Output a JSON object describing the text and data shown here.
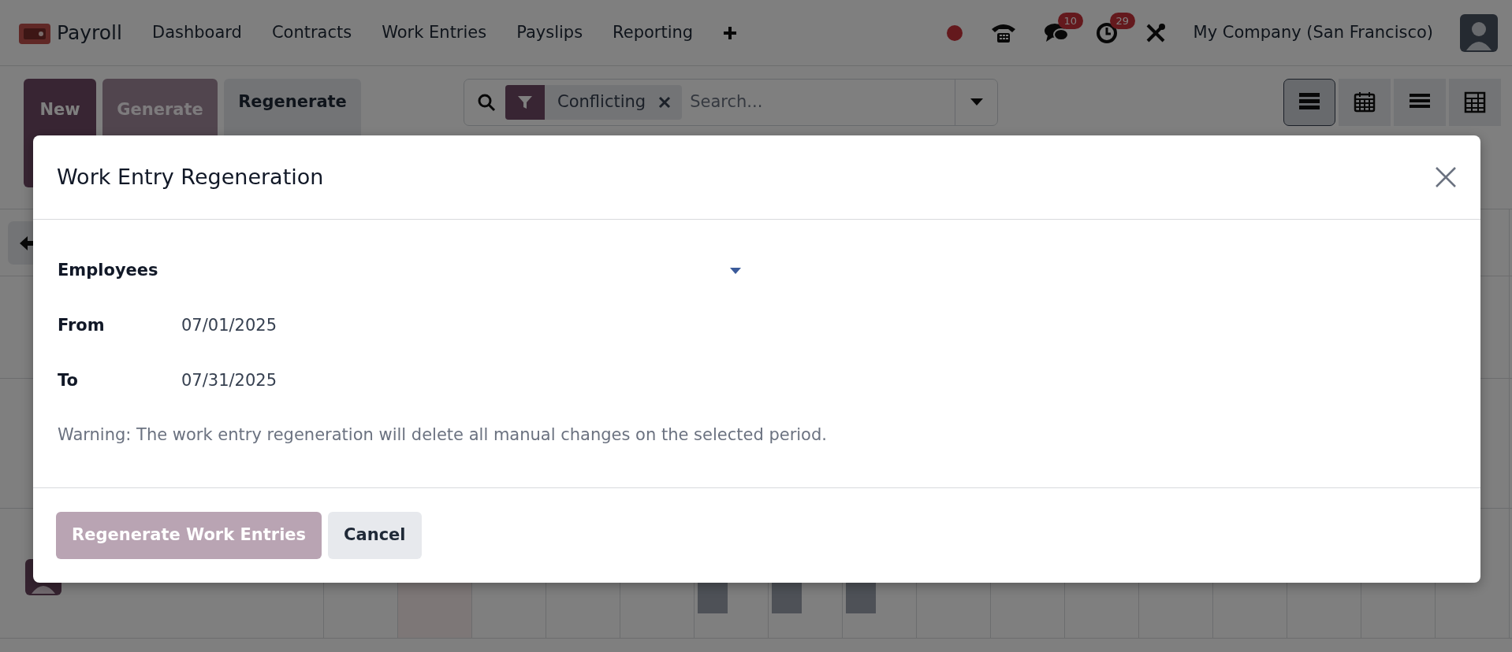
{
  "navbar": {
    "app_name": "Payroll",
    "menu": [
      "Dashboard",
      "Contracts",
      "Work Entries",
      "Payslips",
      "Reporting"
    ],
    "systray": [
      {
        "kind": "record"
      },
      {
        "kind": "phone"
      },
      {
        "kind": "chat",
        "badge": "10"
      },
      {
        "kind": "activity",
        "badge": "29"
      },
      {
        "kind": "tools"
      }
    ],
    "company": "My Company (San Francisco)"
  },
  "control_panel": {
    "buttons": [
      {
        "label": "New",
        "kind": "primary"
      },
      {
        "label": "Generate",
        "kind": "faded"
      },
      {
        "label": "Regenerate",
        "kind": "secondary"
      }
    ],
    "search": {
      "facets": [
        {
          "label": "Conflicting"
        }
      ],
      "placeholder": "Search..."
    },
    "views": [
      {
        "kind": "gantt",
        "selected": true
      },
      {
        "kind": "calendar",
        "selected": false
      },
      {
        "kind": "list",
        "selected": false
      },
      {
        "kind": "pivot",
        "selected": false
      }
    ]
  },
  "dialog": {
    "title": "Work Entry Regeneration",
    "fields": [
      {
        "label": "Employees",
        "kind": "tags"
      },
      {
        "label": "From",
        "kind": "date",
        "value": "07/01/2025"
      },
      {
        "label": "To",
        "kind": "date",
        "value": "07/31/2025"
      }
    ],
    "warning": "Warning: The work entry regeneration will delete all manual changes on the selected period.",
    "buttons": [
      {
        "label": "Regenerate Work Entries",
        "kind": "primary",
        "disabled": true
      },
      {
        "label": "Cancel",
        "kind": "secondary",
        "disabled": false
      }
    ]
  }
}
